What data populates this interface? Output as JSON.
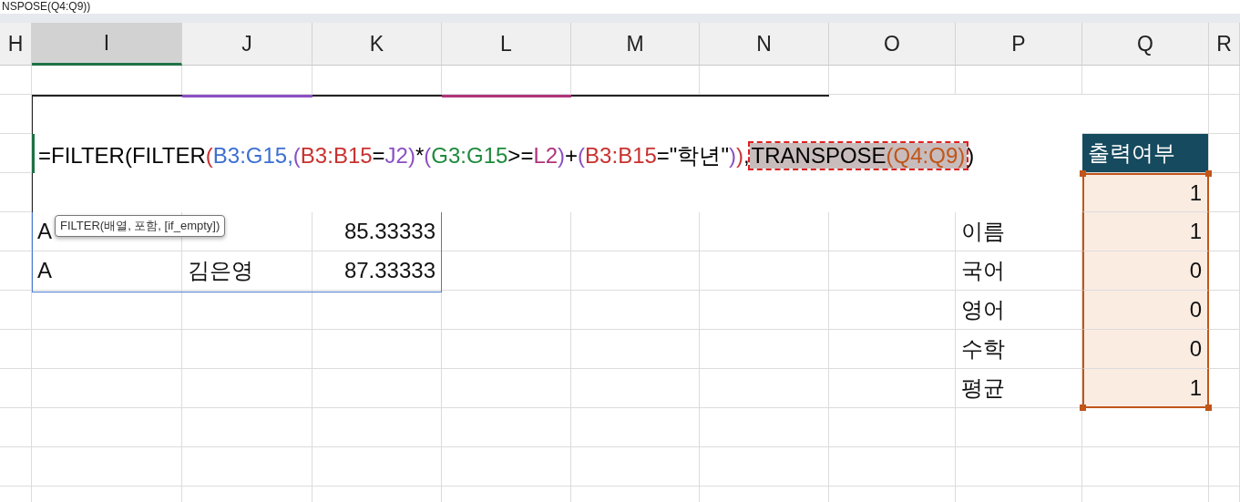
{
  "formula_bar": {
    "text": "NSPOSE(Q4:Q9))"
  },
  "columns": [
    {
      "label": "H",
      "selected": false
    },
    {
      "label": "I",
      "selected": true
    },
    {
      "label": "J",
      "selected": false
    },
    {
      "label": "K",
      "selected": false
    },
    {
      "label": "L",
      "selected": false
    },
    {
      "label": "M",
      "selected": false
    },
    {
      "label": "N",
      "selected": false
    },
    {
      "label": "O",
      "selected": false
    },
    {
      "label": "P",
      "selected": false
    },
    {
      "label": "Q",
      "selected": false
    },
    {
      "label": "R",
      "selected": false
    }
  ],
  "editor": {
    "parts": [
      {
        "text": "=FILTER(FILTER",
        "color": "#000000"
      },
      {
        "text": "(",
        "color": "#c8312f"
      },
      {
        "text": "B3:G15",
        "color": "#3b6fd0"
      },
      {
        "text": ",",
        "color": "#3b6fd0"
      },
      {
        "text": "(",
        "color": "#8a4fc4"
      },
      {
        "text": "B3:B15",
        "color": "#c8312f"
      },
      {
        "text": "=",
        "color": "#000000"
      },
      {
        "text": "J2",
        "color": "#8a4fc4"
      },
      {
        "text": ")",
        "color": "#8a4fc4"
      },
      {
        "text": "*",
        "color": "#000000"
      },
      {
        "text": "(",
        "color": "#8a4fc4"
      },
      {
        "text": "G3:G15",
        "color": "#1e8a3c"
      },
      {
        "text": ">=",
        "color": "#000000"
      },
      {
        "text": "L2",
        "color": "#b0347a"
      },
      {
        "text": ")",
        "color": "#8a4fc4"
      },
      {
        "text": "+",
        "color": "#000000"
      },
      {
        "text": "(",
        "color": "#8a4fc4"
      },
      {
        "text": "B3:B15",
        "color": "#c8312f"
      },
      {
        "text": "=\"학년\"",
        "color": "#000000"
      },
      {
        "text": ")",
        "color": "#8a4fc4"
      },
      {
        "text": ")",
        "color": "#c8312f"
      },
      {
        "text": ",",
        "color": "#000000"
      }
    ],
    "highlighted_argument": [
      {
        "text": "TRANSPOSE",
        "color": "#000000"
      },
      {
        "text": "(Q4:Q9)",
        "color": "#c0561a"
      }
    ],
    "tail": [
      {
        "text": ")",
        "color": "#000000"
      }
    ],
    "tooltip": "FILTER(배열, 포함, [if_empty])"
  },
  "rows": [
    {
      "Q": {
        "text": "출력여부",
        "kind": "header",
        "selected": false
      }
    },
    {
      "Q": {
        "text": "1",
        "kind": "number",
        "selected": true
      }
    },
    {
      "I": {
        "text": "A",
        "kind": "text",
        "selected": false
      },
      "K": {
        "text": "85.33333",
        "kind": "number",
        "selected": false
      },
      "P": {
        "text": "이름",
        "kind": "text",
        "selected": false
      },
      "Q": {
        "text": "1",
        "kind": "number",
        "selected": true
      }
    },
    {
      "I": {
        "text": "A",
        "kind": "text",
        "selected": false
      },
      "J": {
        "text": "김은영",
        "kind": "text",
        "selected": false
      },
      "K": {
        "text": "87.33333",
        "kind": "number",
        "selected": false
      },
      "P": {
        "text": "국어",
        "kind": "text",
        "selected": false
      },
      "Q": {
        "text": "0",
        "kind": "number",
        "selected": true
      }
    },
    {
      "P": {
        "text": "영어",
        "kind": "text",
        "selected": false
      },
      "Q": {
        "text": "0",
        "kind": "number",
        "selected": true
      }
    },
    {
      "P": {
        "text": "수학",
        "kind": "text",
        "selected": false
      },
      "Q": {
        "text": "0",
        "kind": "number",
        "selected": true
      }
    },
    {
      "P": {
        "text": "평균",
        "kind": "text",
        "selected": false
      },
      "Q": {
        "text": "1",
        "kind": "number",
        "selected": true
      }
    }
  ]
}
